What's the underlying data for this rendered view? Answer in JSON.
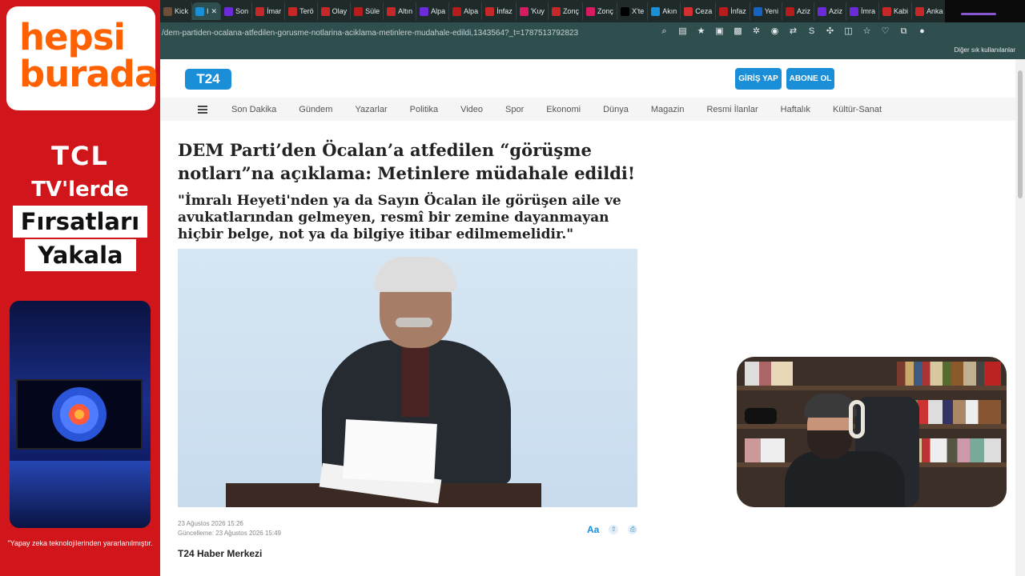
{
  "ad": {
    "brand_line1": "hepsi",
    "brand_line2": "burada",
    "tcl": "TCL",
    "tv": "TV'lerde",
    "line1": "Fırsatları",
    "line2": "Yakala",
    "note": "\"Yapay zeka teknolojilerinden yararlanılmıştır."
  },
  "browser": {
    "tabs": [
      {
        "label": "Kick",
        "color": "#6b4f3a"
      },
      {
        "label": "I",
        "color": "#1a8fd8",
        "active": true,
        "close": "✕"
      },
      {
        "label": "Son",
        "color": "#6c2bd9"
      },
      {
        "label": "İmar",
        "color": "#c62828"
      },
      {
        "label": "Terö",
        "color": "#c62828"
      },
      {
        "label": "Olay",
        "color": "#c62828"
      },
      {
        "label": "Süle",
        "color": "#b71c1c"
      },
      {
        "label": "Altın",
        "color": "#c62828"
      },
      {
        "label": "Alpa",
        "color": "#6c2bd9"
      },
      {
        "label": "Alpa",
        "color": "#b71c1c"
      },
      {
        "label": "İnfaz",
        "color": "#c62828"
      },
      {
        "label": "'Kuy",
        "color": "#d81b60"
      },
      {
        "label": "Zonç",
        "color": "#c62828"
      },
      {
        "label": "Zonç",
        "color": "#d81b60"
      },
      {
        "label": "X'te",
        "color": "#000000"
      },
      {
        "label": "Akın",
        "color": "#1a8fd8"
      },
      {
        "label": "Ceza",
        "color": "#d32f2f"
      },
      {
        "label": "İnfaz",
        "color": "#b71c1c"
      },
      {
        "label": "Yeni",
        "color": "#1565c0"
      },
      {
        "label": "Aziz",
        "color": "#b71c1c"
      },
      {
        "label": "Aziz",
        "color": "#6c2bd9"
      },
      {
        "label": "İmra",
        "color": "#6c2bd9"
      },
      {
        "label": "Kabi",
        "color": "#c62828"
      },
      {
        "label": "Anka",
        "color": "#c62828"
      }
    ],
    "new_tab": "+",
    "url": "/dem-partiden-ocalana-atfedilen-gorusme-notlarina-aciklama-metinlere-mudahale-edildi,1343564?_t=1787513792823",
    "bookmarks_label": "Diğer sık kullanılanlar"
  },
  "site": {
    "logo": "T24",
    "login": "GİRİŞ YAP",
    "subscribe": "ABONE OL",
    "nav": [
      "Son Dakika",
      "Gündem",
      "Yazarlar",
      "Politika",
      "Video",
      "Spor",
      "Ekonomi",
      "Dünya",
      "Magazin",
      "Resmi İlanlar",
      "Haftalık",
      "Kültür-Sanat"
    ]
  },
  "article": {
    "headline": "DEM Parti’den Öcalan’a atfedilen “görüşme notları”na açıklama: Metinlere müdahale edildi!",
    "subhead": "\"İmralı Heyeti'nden ya da Sayın Öcalan ile görüşen aile ve avukatlarından gelmeyen, resmî bir zemine dayanmayan hiçbir belge, not ya da bilgiye itibar edilmemelidir.\"",
    "date": "23 Ağustos 2026 15:26",
    "updated": "Güncelleme: 23 Ağustos 2026 15:49",
    "font_tool": "Aa",
    "byline": "T24 Haber Merkezi"
  },
  "colors": {
    "accent": "#1a8fd8",
    "ad_red": "#d0161b",
    "brand_orange": "#ff6000"
  }
}
